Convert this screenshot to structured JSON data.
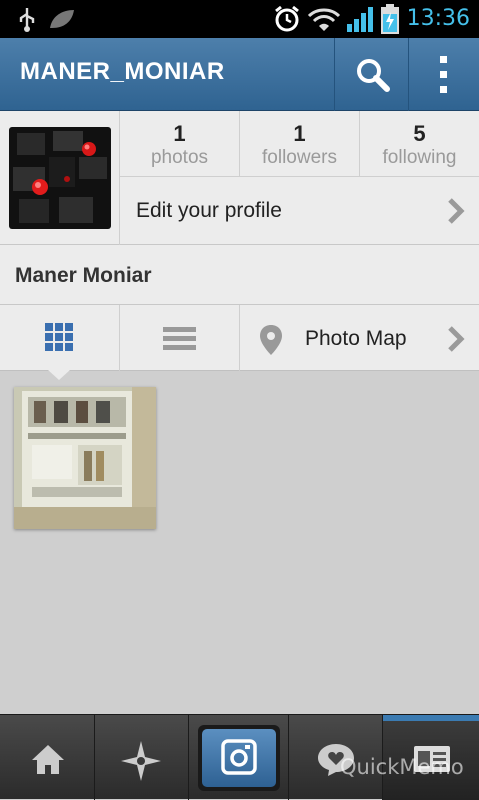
{
  "status_bar": {
    "time": "13:36",
    "icons": [
      "usb-icon",
      "leaf-icon",
      "alarm-icon",
      "wifi-icon",
      "signal-icon",
      "battery-charging-icon"
    ]
  },
  "header": {
    "username": "MANER_MONIAR",
    "color": "#3a6e9c",
    "search_icon": "search-icon",
    "menu_icon": "overflow-menu-icon"
  },
  "profile": {
    "stats": [
      {
        "count": "1",
        "label": "photos"
      },
      {
        "count": "1",
        "label": "followers"
      },
      {
        "count": "5",
        "label": "following"
      }
    ],
    "edit_label": "Edit your profile",
    "full_name": "Maner Moniar"
  },
  "tabs": {
    "grid_icon": "grid-view-icon",
    "list_icon": "list-view-icon",
    "map_label": "Photo Map",
    "grid_color": "#3a6fb0"
  },
  "bottom_nav": {
    "items": [
      "home-icon",
      "explore-icon",
      "camera-icon",
      "activity-heart-icon",
      "profile-card-icon"
    ],
    "active_color": "#3b7bb2"
  },
  "overlay": {
    "quickmemo": "QuickMemo"
  }
}
